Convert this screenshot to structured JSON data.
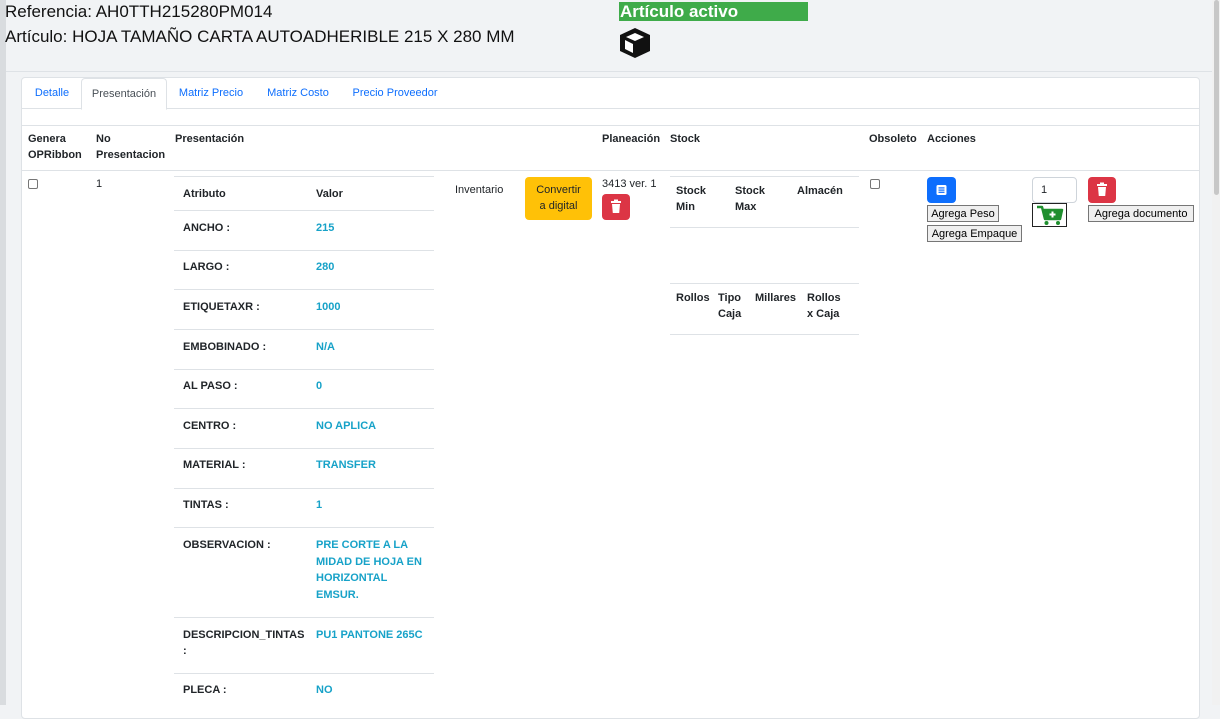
{
  "header": {
    "reference": "Referencia: AH0TTH215280PM014",
    "article": "Artículo: HOJA TAMAÑO CARTA AUTOADHERIBLE 215 X 280 MM",
    "active_badge": "Artículo activo",
    "badge_color": "#3fab4a"
  },
  "tabs": [
    "Detalle",
    "Presentación",
    "Matriz Precio",
    "Matriz Costo",
    "Precio Proveedor"
  ],
  "active_tab": "Presentación",
  "table": {
    "headers": {
      "genera_line1": "Genera",
      "genera_line2": "OPRibbon",
      "no_line1": "No",
      "no_line2": "Presentacion",
      "presentacion": "Presentación",
      "planeacion": "Planeación",
      "stock": "Stock",
      "obsoleto": "Obsoleto",
      "acciones": "Acciones"
    },
    "row": {
      "no_presentacion": "1",
      "inventario": "Inventario",
      "convert_button_line1": "Convertir",
      "convert_button_line2": "a digital",
      "planeacion": "3413 ver. 1",
      "quantity": "1",
      "agrega_peso": "Agrega Peso",
      "agrega_empaque": "Agrega Empaque",
      "agrega_documento": "Agrega documento"
    },
    "attributes": {
      "header_attr": "Atributo",
      "header_val": "Valor",
      "items": [
        {
          "name": "ANCHO :",
          "value": "215"
        },
        {
          "name": "LARGO :",
          "value": "280"
        },
        {
          "name": "ETIQUETAXR :",
          "value": "1000"
        },
        {
          "name": "EMBOBINADO :",
          "value": "N/A"
        },
        {
          "name": "AL PASO :",
          "value": "0"
        },
        {
          "name": "CENTRO :",
          "value": "NO APLICA"
        },
        {
          "name": "MATERIAL :",
          "value": "TRANSFER"
        },
        {
          "name": "TINTAS :",
          "value": "1"
        },
        {
          "name": "OBSERVACION :",
          "value_lines": [
            "PRE CORTE A LA",
            "MIDAD DE HOJA EN",
            "HORIZONTAL",
            "EMSUR."
          ]
        },
        {
          "name_lines": [
            "DESCRIPCION_TINTAS",
            ":"
          ],
          "value": "PU1 PANTONE 265C"
        },
        {
          "name": "PLECA :",
          "value": "NO"
        }
      ]
    },
    "stock": {
      "stock_min_line1": "Stock",
      "stock_min_line2": "Min",
      "stock_max_line1": "Stock",
      "stock_max_line2": "Max",
      "almacen": "Almacén",
      "rollos": "Rollos",
      "tipo_caja_line1": "Tipo",
      "tipo_caja_line2": "Caja",
      "millares": "Millares",
      "rollos_caja_line1": "Rollos",
      "rollos_caja_line2": "x Caja"
    }
  },
  "colors": {
    "link": "#0d6efd",
    "value_text": "#17a2c8",
    "warning": "#ffc107",
    "danger": "#dc3545",
    "cart_green": "#1f8f2e"
  },
  "icons": [
    "box-icon",
    "trash-icon",
    "list-icon",
    "cart-plus-icon"
  ]
}
